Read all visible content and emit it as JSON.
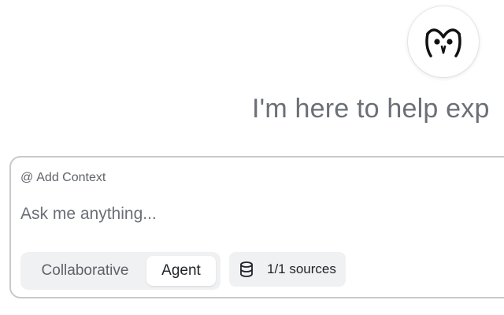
{
  "header": {
    "logo_icon": "owl-icon",
    "greeting": "I'm here to help exp"
  },
  "composer": {
    "add_context_icon": "at-icon",
    "add_context_label": "Add Context",
    "input_placeholder": "Ask me anything...",
    "input_value": "",
    "modes": [
      {
        "label": "Collaborative",
        "selected": false
      },
      {
        "label": "Agent",
        "selected": true
      }
    ],
    "sources_icon": "database-icon",
    "sources_label": "1/1 sources"
  },
  "colors": {
    "greeting_text": "#6b6f76",
    "border": "#c9c9cc",
    "chip_background": "#f0f1f3",
    "selected_mode_background": "#ffffff"
  }
}
